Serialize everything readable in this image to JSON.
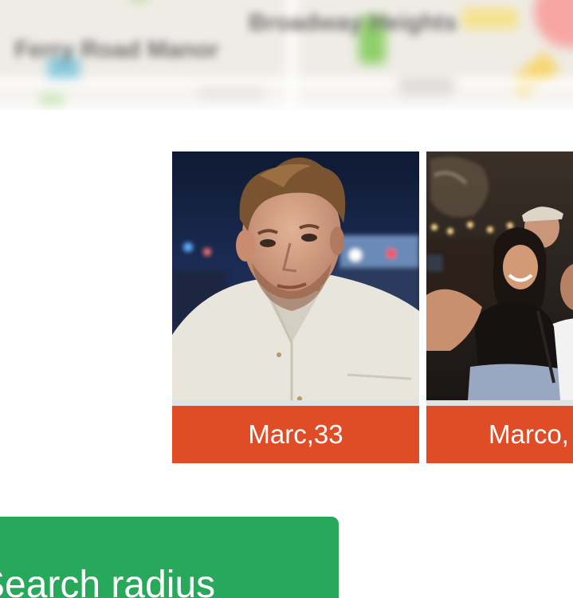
{
  "map": {
    "labels": [
      "Ferry Road Manor",
      "Broadway Heights"
    ]
  },
  "profiles": [
    {
      "label": "Marc,33"
    },
    {
      "label": "Marco,"
    }
  ],
  "search_button": {
    "label": "Search radius"
  },
  "colors": {
    "card_label_bg": "#e04c26",
    "button_bg": "#27a85a"
  }
}
